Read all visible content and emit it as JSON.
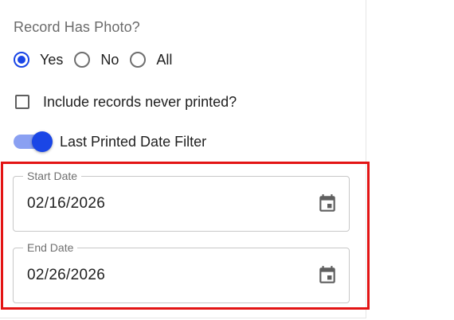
{
  "record_photo": {
    "label": "Record Has Photo?",
    "options": [
      {
        "label": "Yes",
        "checked": true
      },
      {
        "label": "No",
        "checked": false
      },
      {
        "label": "All",
        "checked": false
      }
    ]
  },
  "never_printed": {
    "label": "Include records never printed?",
    "checked": false
  },
  "last_printed_toggle": {
    "label": "Last Printed Date Filter",
    "on": true
  },
  "start_date": {
    "label": "Start Date",
    "value": "02/16/2026",
    "icon": "calendar-icon"
  },
  "end_date": {
    "label": "End Date",
    "value": "02/26/2026",
    "icon": "calendar-icon"
  },
  "colors": {
    "accent": "#1a46e6",
    "accent_light": "#8aa0f2",
    "highlight": "#e31414"
  }
}
